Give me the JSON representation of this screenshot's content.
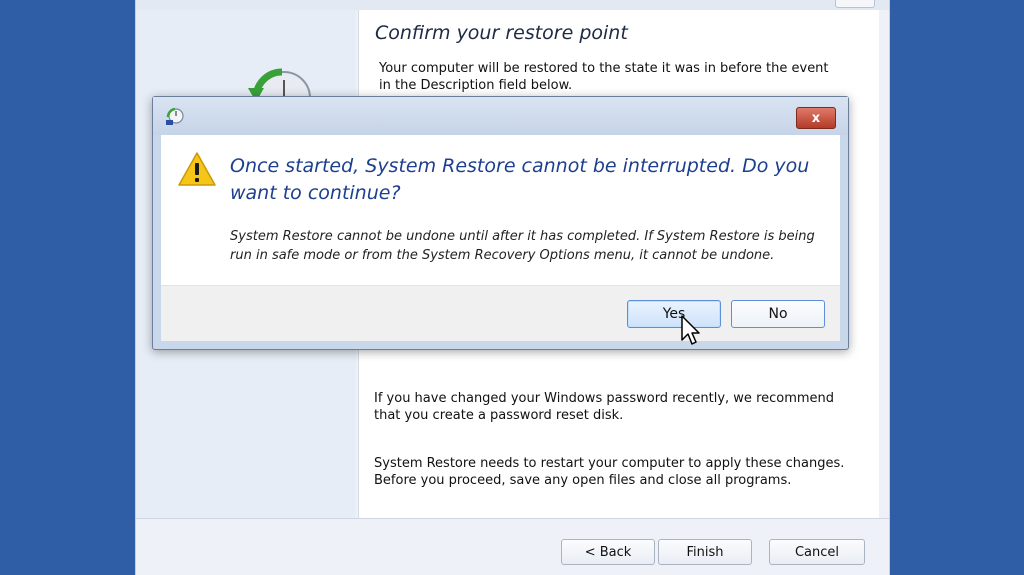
{
  "wizard": {
    "title": "Confirm your restore point",
    "description": "Your computer will be restored to the state it was in before the event in the Description field below.",
    "password_note": "If you have changed your Windows password recently, we recommend that you create a password reset disk.",
    "restart_note": "System Restore needs to restart your computer to apply these changes. Before you proceed, save any open files and close all programs.",
    "buttons": {
      "back": "< Back",
      "finish": "Finish",
      "cancel": "Cancel"
    }
  },
  "dialog": {
    "close_label": "x",
    "main_instruction": "Once started, System Restore cannot be interrupted. Do you want to continue?",
    "content": "System Restore cannot be undone until after it has completed. If System Restore is being run in safe mode or from the System Recovery Options menu, it cannot be undone.",
    "buttons": {
      "yes": "Yes",
      "no": "No"
    }
  },
  "icons": {
    "dialog_title": "system-restore-icon",
    "warning": "warning-icon",
    "cursor": "mouse-pointer-icon",
    "wizard_graphic": "restore-clock-icon"
  },
  "colors": {
    "background": "#2f5ea7",
    "instruction_text": "#1d3f8f",
    "close_button": "#c0392b"
  }
}
